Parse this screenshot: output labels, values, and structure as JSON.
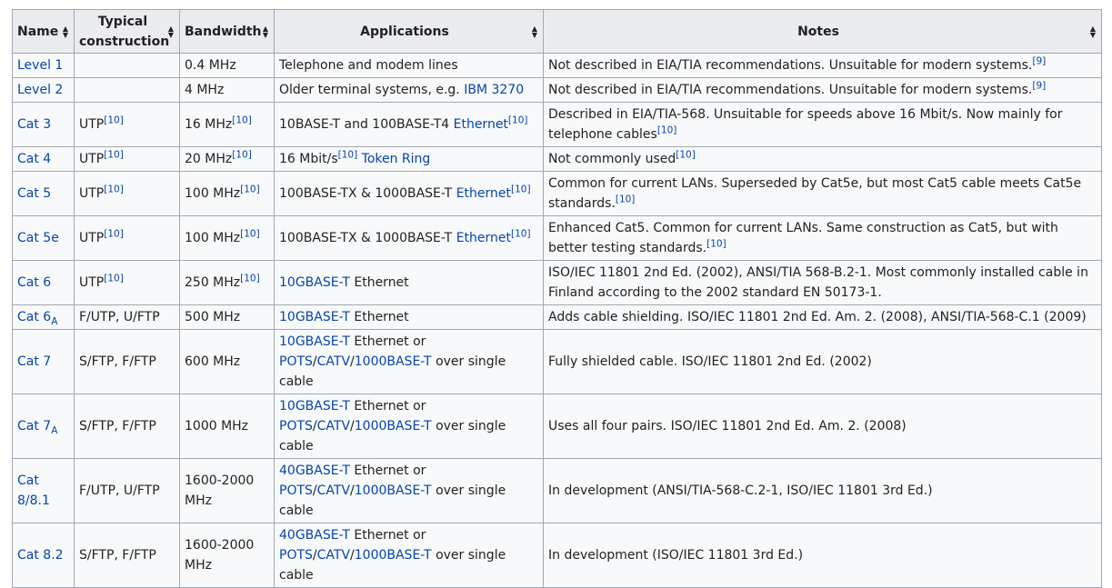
{
  "headers": {
    "name": "Name",
    "construction": "Typical construction",
    "bandwidth": "Bandwidth",
    "applications": "Applications",
    "notes": "Notes"
  },
  "rows": [
    {
      "name": [
        {
          "t": "Level 1",
          "link": true
        }
      ],
      "construction": [],
      "bandwidth": [
        {
          "t": "0.4 MHz"
        }
      ],
      "applications": [
        {
          "t": "Telephone and modem lines"
        }
      ],
      "notes": [
        {
          "t": "Not described in EIA/TIA recommendations. Unsuitable for modern systems."
        },
        {
          "t": "[9]",
          "sup": true,
          "link": true
        }
      ]
    },
    {
      "name": [
        {
          "t": "Level 2",
          "link": true
        }
      ],
      "construction": [],
      "bandwidth": [
        {
          "t": "4 MHz"
        }
      ],
      "applications": [
        {
          "t": "Older terminal systems, e.g. "
        },
        {
          "t": "IBM 3270",
          "link": true
        }
      ],
      "notes": [
        {
          "t": "Not described in EIA/TIA recommendations. Unsuitable for modern systems."
        },
        {
          "t": "[9]",
          "sup": true,
          "link": true
        }
      ]
    },
    {
      "name": [
        {
          "t": "Cat 3",
          "link": true
        }
      ],
      "construction": [
        {
          "t": "UTP"
        },
        {
          "t": "[10]",
          "sup": true,
          "link": true
        }
      ],
      "bandwidth": [
        {
          "t": "16 MHz"
        },
        {
          "t": "[10]",
          "sup": true,
          "link": true
        }
      ],
      "applications": [
        {
          "t": "10BASE-T and 100BASE-T4 "
        },
        {
          "t": "Ethernet",
          "link": true
        },
        {
          "t": "[10]",
          "sup": true,
          "link": true
        }
      ],
      "notes": [
        {
          "t": "Described in EIA/TIA-568. Unsuitable for speeds above 16 Mbit/s. Now mainly for telephone cables"
        },
        {
          "t": "[10]",
          "sup": true,
          "link": true
        }
      ]
    },
    {
      "name": [
        {
          "t": "Cat 4",
          "link": true
        }
      ],
      "construction": [
        {
          "t": "UTP"
        },
        {
          "t": "[10]",
          "sup": true,
          "link": true
        }
      ],
      "bandwidth": [
        {
          "t": "20 MHz"
        },
        {
          "t": "[10]",
          "sup": true,
          "link": true
        }
      ],
      "applications": [
        {
          "t": "16 Mbit/s"
        },
        {
          "t": "[10]",
          "sup": true,
          "link": true
        },
        {
          "t": " "
        },
        {
          "t": "Token Ring",
          "link": true
        }
      ],
      "notes": [
        {
          "t": "Not commonly used"
        },
        {
          "t": "[10]",
          "sup": true,
          "link": true
        }
      ]
    },
    {
      "name": [
        {
          "t": "Cat 5",
          "link": true
        }
      ],
      "construction": [
        {
          "t": "UTP"
        },
        {
          "t": "[10]",
          "sup": true,
          "link": true
        }
      ],
      "bandwidth": [
        {
          "t": "100 MHz"
        },
        {
          "t": "[10]",
          "sup": true,
          "link": true
        }
      ],
      "applications": [
        {
          "t": "100BASE-TX & 1000BASE-T "
        },
        {
          "t": "Ethernet",
          "link": true
        },
        {
          "t": "[10]",
          "sup": true,
          "link": true
        }
      ],
      "notes": [
        {
          "t": "Common for current LANs. Superseded by Cat5e, but most Cat5 cable meets Cat5e standards."
        },
        {
          "t": "[10]",
          "sup": true,
          "link": true
        }
      ]
    },
    {
      "name": [
        {
          "t": "Cat 5e",
          "link": true
        }
      ],
      "construction": [
        {
          "t": "UTP"
        },
        {
          "t": "[10]",
          "sup": true,
          "link": true
        }
      ],
      "bandwidth": [
        {
          "t": "100 MHz"
        },
        {
          "t": "[10]",
          "sup": true,
          "link": true
        }
      ],
      "applications": [
        {
          "t": "100BASE-TX & 1000BASE-T "
        },
        {
          "t": "Ethernet",
          "link": true
        },
        {
          "t": "[10]",
          "sup": true,
          "link": true
        }
      ],
      "notes": [
        {
          "t": "Enhanced Cat5. Common for current LANs. Same construction as Cat5, but with better testing standards."
        },
        {
          "t": "[10]",
          "sup": true,
          "link": true
        }
      ]
    },
    {
      "name": [
        {
          "t": "Cat 6",
          "link": true
        }
      ],
      "construction": [
        {
          "t": "UTP"
        },
        {
          "t": "[10]",
          "sup": true,
          "link": true
        }
      ],
      "bandwidth": [
        {
          "t": "250 MHz"
        },
        {
          "t": "[10]",
          "sup": true,
          "link": true
        }
      ],
      "applications": [
        {
          "t": "10GBASE-T",
          "link": true
        },
        {
          "t": " Ethernet"
        }
      ],
      "notes": [
        {
          "t": "ISO/IEC 11801 2nd Ed. (2002), ANSI/TIA 568-B.2-1. Most commonly installed cable in Finland according to the 2002 standard EN 50173-1."
        }
      ]
    },
    {
      "name": [
        {
          "t": "Cat 6",
          "link": true
        },
        {
          "t": "A",
          "sub": true,
          "link": true
        }
      ],
      "construction": [
        {
          "t": "F/UTP, U/FTP"
        }
      ],
      "bandwidth": [
        {
          "t": "500 MHz"
        }
      ],
      "applications": [
        {
          "t": "10GBASE-T",
          "link": true
        },
        {
          "t": " Ethernet"
        }
      ],
      "notes": [
        {
          "t": "Adds cable shielding. ISO/IEC 11801 2nd Ed. Am. 2. (2008), ANSI/TIA-568-C.1 (2009)"
        }
      ]
    },
    {
      "name": [
        {
          "t": "Cat 7",
          "link": true
        }
      ],
      "construction": [
        {
          "t": "S/FTP, F/FTP"
        }
      ],
      "bandwidth": [
        {
          "t": "600 MHz"
        }
      ],
      "applications": [
        {
          "t": "10GBASE-T",
          "link": true
        },
        {
          "t": " Ethernet or "
        },
        {
          "t": "POTS",
          "link": true
        },
        {
          "t": "/"
        },
        {
          "t": "CATV",
          "link": true
        },
        {
          "t": "/"
        },
        {
          "t": "1000BASE-T",
          "link": true
        },
        {
          "t": " over single cable"
        }
      ],
      "notes": [
        {
          "t": "Fully shielded cable. ISO/IEC 11801 2nd Ed. (2002)"
        }
      ]
    },
    {
      "name": [
        {
          "t": "Cat 7",
          "link": true
        },
        {
          "t": "A",
          "sub": true,
          "link": true
        }
      ],
      "construction": [
        {
          "t": "S/FTP, F/FTP"
        }
      ],
      "bandwidth": [
        {
          "t": "1000 MHz"
        }
      ],
      "applications": [
        {
          "t": "10GBASE-T",
          "link": true
        },
        {
          "t": " Ethernet or "
        },
        {
          "t": "POTS",
          "link": true
        },
        {
          "t": "/"
        },
        {
          "t": "CATV",
          "link": true
        },
        {
          "t": "/"
        },
        {
          "t": "1000BASE-T",
          "link": true
        },
        {
          "t": " over single cable"
        }
      ],
      "notes": [
        {
          "t": "Uses all four pairs. ISO/IEC 11801 2nd Ed. Am. 2. (2008)"
        }
      ]
    },
    {
      "name": [
        {
          "t": "Cat 8/8.1",
          "link": true
        }
      ],
      "construction": [
        {
          "t": "F/UTP, U/FTP"
        }
      ],
      "bandwidth": [
        {
          "t": "1600-2000 MHz"
        }
      ],
      "applications": [
        {
          "t": "40GBASE-T",
          "link": true
        },
        {
          "t": " Ethernet or "
        },
        {
          "t": "POTS",
          "link": true
        },
        {
          "t": "/"
        },
        {
          "t": "CATV",
          "link": true
        },
        {
          "t": "/"
        },
        {
          "t": "1000BASE-T",
          "link": true
        },
        {
          "t": " over single cable"
        }
      ],
      "notes": [
        {
          "t": "In development (ANSI/TIA-568-C.2-1, ISO/IEC 11801 3rd Ed.)"
        }
      ]
    },
    {
      "name": [
        {
          "t": "Cat 8.2",
          "link": true
        }
      ],
      "construction": [
        {
          "t": "S/FTP, F/FTP"
        }
      ],
      "bandwidth": [
        {
          "t": "1600-2000 MHz"
        }
      ],
      "applications": [
        {
          "t": "40GBASE-T",
          "link": true
        },
        {
          "t": " Ethernet or "
        },
        {
          "t": "POTS",
          "link": true
        },
        {
          "t": "/"
        },
        {
          "t": "CATV",
          "link": true
        },
        {
          "t": "/"
        },
        {
          "t": "1000BASE-T",
          "link": true
        },
        {
          "t": " over single cable"
        }
      ],
      "notes": [
        {
          "t": "In development (ISO/IEC 11801 3rd Ed.)"
        }
      ]
    }
  ],
  "colors": {
    "link": "#0645ad",
    "header_bg": "#eaecf0",
    "cell_bg": "#f8f9fa",
    "border": "#a2a9b1"
  },
  "icons": {
    "sort": "sort-arrows-icon"
  }
}
